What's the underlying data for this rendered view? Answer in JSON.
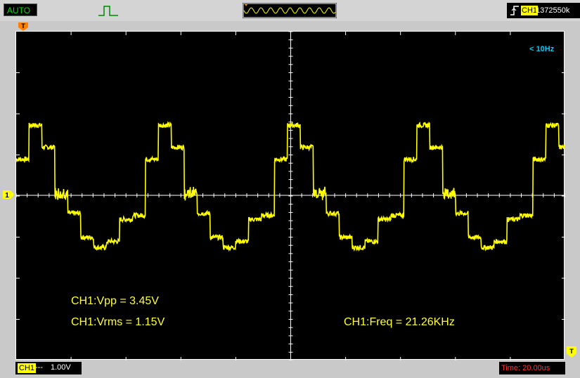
{
  "topbar": {
    "mode": "AUTO",
    "trigger_channel": "CH1",
    "trigger_value": "1372550k"
  },
  "screen": {
    "low_freq_note": "< 10Hz",
    "vpp": "CH1:Vpp = 3.45V",
    "vrms": "CH1:Vrms = 1.15V",
    "freq": "CH1:Freq = 21.26KHz",
    "trigger_marker": "T",
    "channel_marker": "1",
    "bottom_trigger_marker": "T"
  },
  "bottombar": {
    "channel": "CH1",
    "coupling": "---",
    "scale": "1.00V",
    "time": "Time: 20.00us"
  },
  "colors": {
    "trace": "#ffff00",
    "grid": "#ffffff",
    "marker": "#ff8000",
    "note": "#00c8ff",
    "time": "#ff3030"
  },
  "waveform": {
    "period_us": 47.0,
    "cycles_shown": 4.25,
    "levels_v": [
      0.9,
      1.75,
      1.2,
      0.05,
      -0.45,
      -1.05,
      -1.3,
      -1.15,
      -0.6,
      -0.5
    ]
  }
}
